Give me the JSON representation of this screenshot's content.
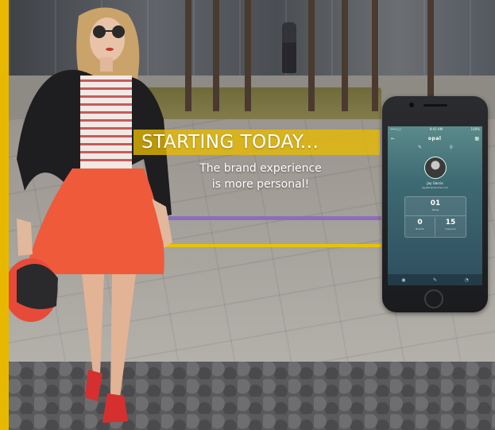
{
  "ad": {
    "headline": "STARTING TODAY...",
    "subline_1": "The brand experience",
    "subline_2": "is more personal!"
  },
  "colors": {
    "accent": "#e8b800",
    "headline_band": "#e8bb00",
    "stripe_purple": "#8a6fb8",
    "stripe_yellow": "#e8c300",
    "app_gradient_top": "#5b8a8a",
    "app_gradient_bottom": "#2e4e5e"
  },
  "phone_app": {
    "status_left": "•••○○ ",
    "status_center": "9:41 AM",
    "status_right": "100%",
    "logo": "opal",
    "back_icon": "back-arrow-icon",
    "menu_icon": "qr-code-icon",
    "tools": [
      "✎",
      "⚲"
    ],
    "user_name": "Jay Garcia",
    "user_email": "jay@brandonline.com",
    "stats": {
      "top": {
        "value": "01",
        "label": "Items"
      },
      "left": {
        "value": "0",
        "label": "Brands"
      },
      "right": {
        "value": "15",
        "label": "Coupons"
      }
    },
    "tabs": [
      "◉",
      "✎",
      "◔"
    ]
  }
}
